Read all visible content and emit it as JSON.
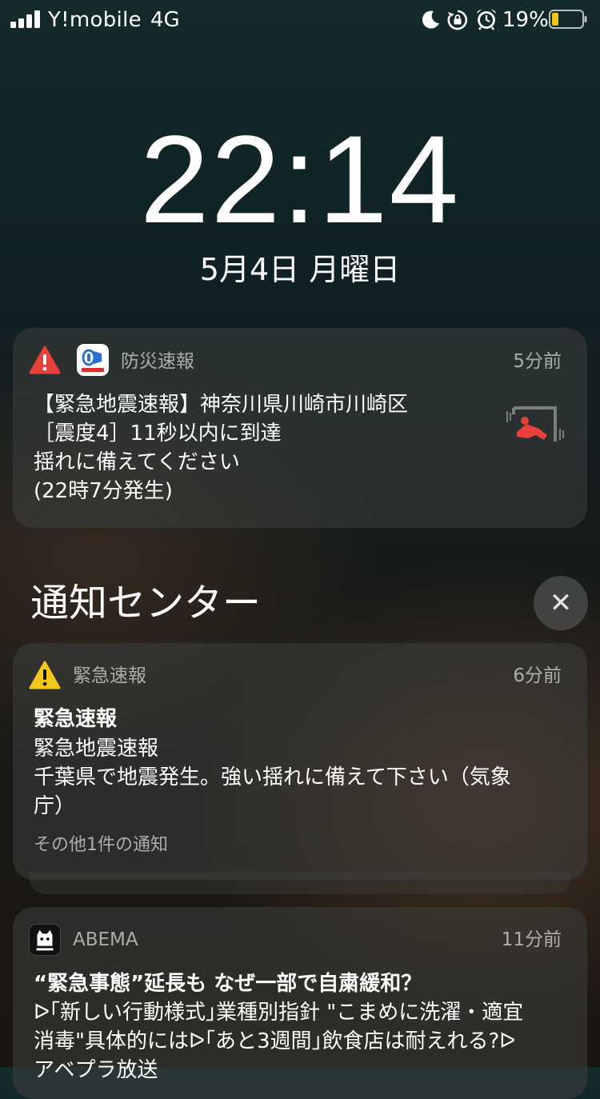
{
  "status_bar": {
    "carrier": "Y!mobile",
    "network": "4G",
    "battery_percent": "19%",
    "battery_level": 0.19,
    "battery_color": "#f5c518",
    "icons": [
      "signal-icon",
      "moon-icon",
      "rotation-lock-icon",
      "alarm-icon",
      "battery-icon"
    ]
  },
  "lock_screen": {
    "time": "22:14",
    "date": "5月4日 月曜日"
  },
  "notifications": {
    "bosai": {
      "app_name": "防災速報",
      "time_ago": "5分前",
      "lines": [
        "【緊急地震速報】神奈川県川崎市川崎区",
        "［震度4］11秒以内に到達",
        "揺れに備えてください",
        "(22時7分発生)"
      ],
      "icon": "yahoo-bosai-icon",
      "alert_color": "#e8403a"
    },
    "center_title": "通知センター",
    "close_label": "✕",
    "emergency": {
      "app_name": "緊急速報",
      "time_ago": "6分前",
      "title": "緊急速報",
      "lines": [
        "緊急地震速報",
        "千葉県で地震発生。強い揺れに備えて下さい（気象",
        "庁）"
      ],
      "more": "その他1件の通知",
      "alert_color": "#f2c81e"
    },
    "abema": {
      "app_name": "ABEMA",
      "time_ago": "11分前",
      "title": "“緊急事態”延長も なぜ一部で自粛緩和？",
      "lines": [
        "ᐅ｢新しい行動様式｣業種別指針 \"こまめに洗濯・適宜",
        "消毒\"具体的にはᐅ｢あと3週間｣飲食店は耐えれる?ᐅ",
        "アベプラ放送"
      ]
    }
  }
}
